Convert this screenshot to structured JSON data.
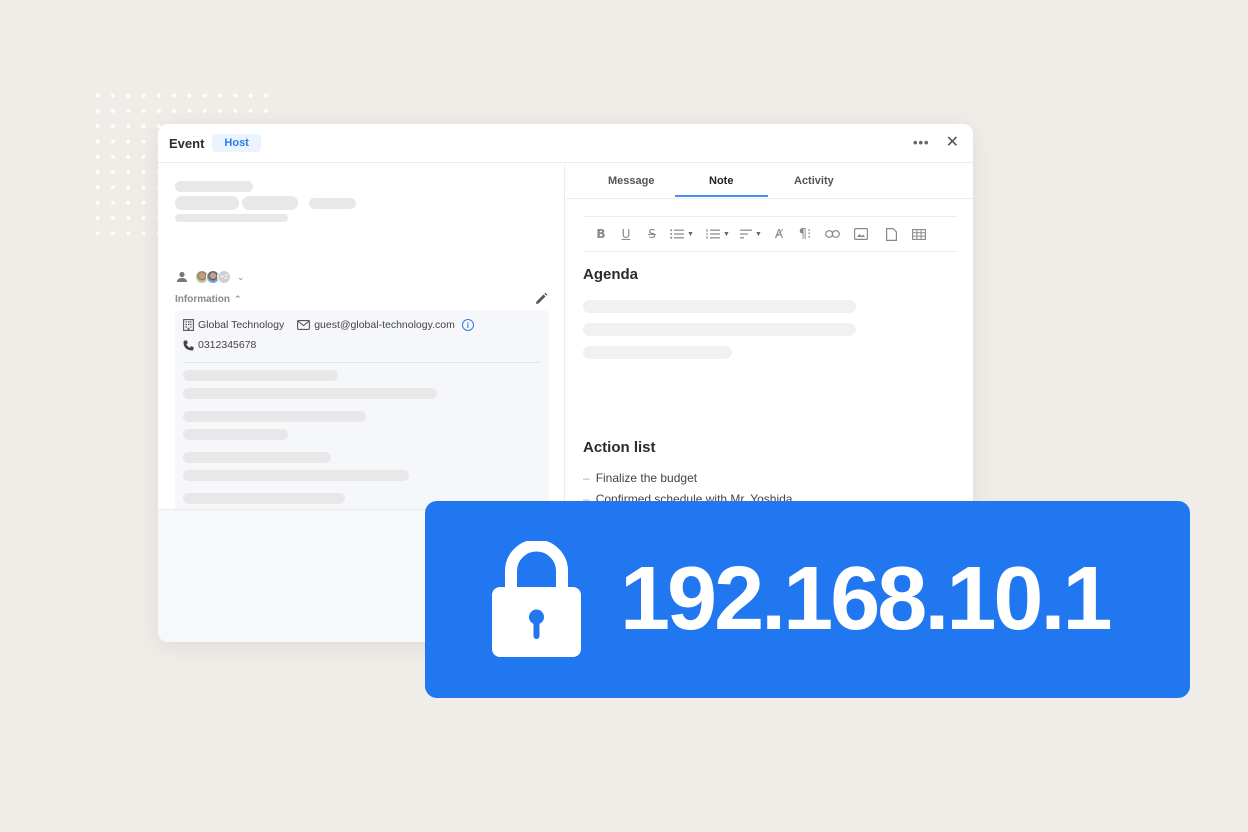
{
  "window": {
    "title": "Event",
    "badge": "Host",
    "more_label": "•••",
    "close_label": "✕"
  },
  "attendees": {
    "extra_count": "+2"
  },
  "information": {
    "header": "Information",
    "company": "Global Technology",
    "email": "guest@global-technology.com",
    "phone": "0312345678",
    "info_icon": "i"
  },
  "tabs": [
    {
      "label": "Message",
      "active": false
    },
    {
      "label": "Note",
      "active": true
    },
    {
      "label": "Activity",
      "active": false
    }
  ],
  "toolbar": {
    "items": [
      "bold-icon",
      "underline-icon",
      "strikethrough-icon",
      "bullet-list-icon",
      "numbered-list-icon",
      "align-icon",
      "clear-format-icon",
      "paragraph-icon",
      "link-icon",
      "image-icon",
      "file-icon",
      "table-icon"
    ]
  },
  "note": {
    "agenda_heading": "Agenda",
    "action_heading": "Action list",
    "action_items": [
      "Finalize the budget",
      "Confirmed schedule with Mr. Yoshida"
    ]
  },
  "banner": {
    "ip_address": "192.168.10.1",
    "icon": "lock-icon",
    "color": "#2177f0"
  },
  "colors": {
    "background": "#f0ede8",
    "accent": "#2f7be6",
    "badge_bg": "#eaf3fe"
  }
}
